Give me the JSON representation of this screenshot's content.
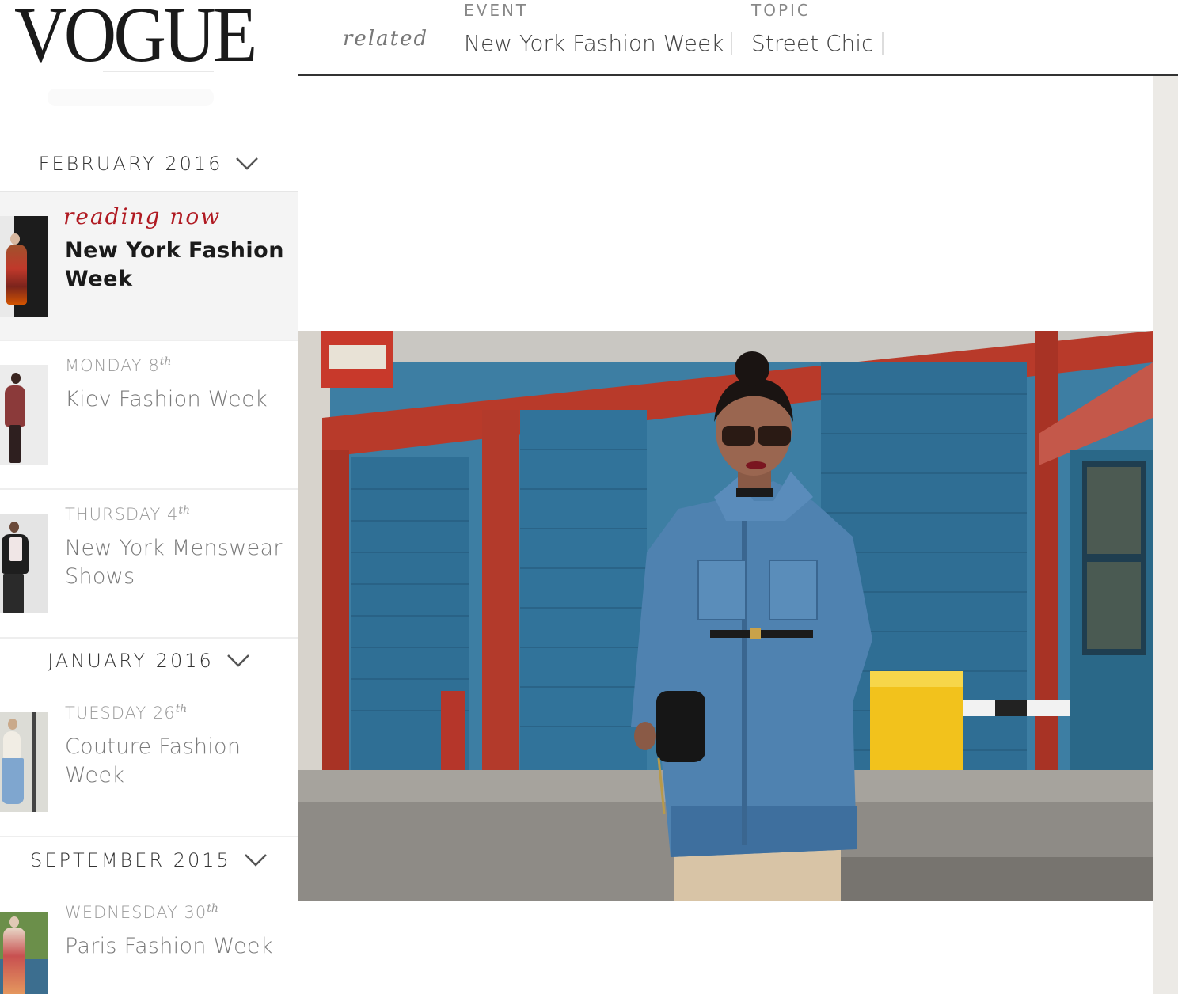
{
  "logo": {
    "text": "VOGUE"
  },
  "header": {
    "related_label": "related",
    "event": {
      "label": "EVENT",
      "link": "New York Fashion Week"
    },
    "topic": {
      "label": "TOPIC",
      "link": "Street Chic"
    }
  },
  "sidebar": {
    "months": [
      {
        "label": "FEBRUARY 2016"
      },
      {
        "label": "JANUARY 2016"
      },
      {
        "label": "SEPTEMBER 2015"
      }
    ],
    "current": {
      "reading_label": "reading now",
      "title": "New York Fashion Week"
    },
    "items": [
      {
        "day": "MONDAY 8",
        "suffix": "th",
        "title": "Kiev Fashion Week"
      },
      {
        "day": "THURSDAY 4",
        "suffix": "th",
        "title": "New York Menswear Shows"
      },
      {
        "day": "TUESDAY 26",
        "suffix": "th",
        "title": "Couture Fashion Week"
      },
      {
        "day": "WEDNESDAY 30",
        "suffix": "th",
        "title": "Paris Fashion Week"
      }
    ]
  },
  "photo": {
    "alt": "street style denim coat"
  },
  "colors": {
    "accent": "#b01a22",
    "wall_blue": "#3d7ea3",
    "beam_red": "#b83a2a",
    "post_yellow": "#f2c21c"
  }
}
